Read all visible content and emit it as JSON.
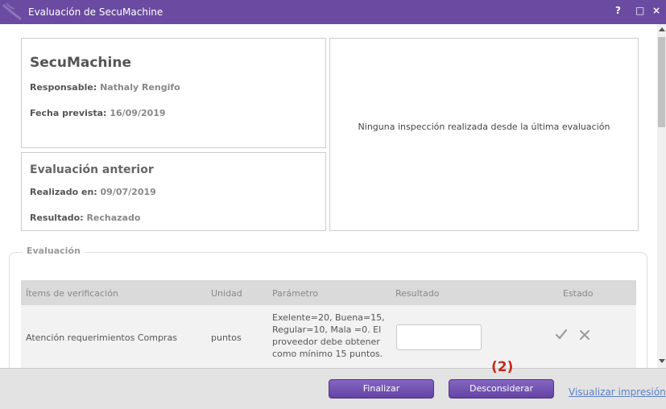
{
  "window": {
    "title": "Evaluación de SecuMachine",
    "controls": {
      "help": "?",
      "maximize": "□",
      "close": "×"
    }
  },
  "machine": {
    "name": "SecuMachine",
    "responsable_label": "Responsable:",
    "responsable_value": "Nathaly Rengifo",
    "fecha_label": "Fecha prevista:",
    "fecha_value": "16/09/2019"
  },
  "previous": {
    "title": "Evaluación anterior",
    "realizado_label": "Realizado en:",
    "realizado_value": "09/07/2019",
    "resultado_label": "Resultado:",
    "resultado_value": "Rechazado"
  },
  "inspection_message": "Ninguna inspección realizada desde la última evaluación",
  "evaluation": {
    "legend": "Evaluación",
    "columns": {
      "item": "Ítems de verificación",
      "unit": "Unidad",
      "param": "Parámetro",
      "result": "Resultado",
      "state": "Estado"
    },
    "rows": [
      {
        "item": "Atención requerimientos Compras",
        "unit": "puntos",
        "param": "Exelente=20, Buena=15, Regular=10, Mala =0. El proveedor debe obtener como mínimo 15 puntos.",
        "result": ""
      }
    ]
  },
  "footer": {
    "finalize": "Finalizar",
    "disregard": "Desconsiderar",
    "marker": "(2)",
    "print_link": "Visualizar impresión"
  },
  "colors": {
    "titlebar": "#6b4ba1",
    "button": "#6b4ba1",
    "marker": "#c6281b",
    "link": "#5b7fc7"
  },
  "icons": [
    "logo-icon",
    "check-icon",
    "x-icon"
  ]
}
